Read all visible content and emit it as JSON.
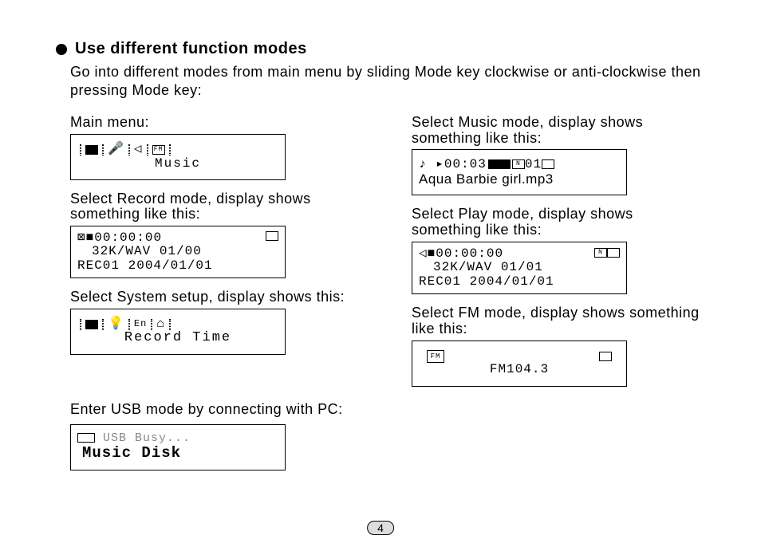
{
  "heading": "Use different function modes",
  "intro": "Go into different modes from main menu by sliding Mode key clockwise or anti-clockwise then pressing Mode key:",
  "left": {
    "main_menu_caption": "Main menu:",
    "main_menu_label": "Music",
    "record_caption": "Select Record mode, display shows something like this:",
    "record_line1": "■00:00:00",
    "record_line2": "32K/WAV 01/00",
    "record_line3": "REC01 2004/01/01",
    "system_caption": "Select System setup, display shows this:",
    "system_label": "Record Time",
    "usb_caption": "Enter USB mode by connecting with PC:",
    "usb_line1": "USB Busy...",
    "usb_line2": "Music Disk"
  },
  "right": {
    "music_caption": "Select Music mode, display shows something like this:",
    "music_line1": "♪ ▸00:03",
    "music_count": "01",
    "music_song": "Aqua Barbie girl.mp3",
    "play_caption": "Select Play mode, display shows something like this:",
    "play_line1": "◁■00:00:00",
    "play_line2": "32K/WAV 01/01",
    "play_line3": "REC01 2004/01/01",
    "fm_caption": "Select FM mode, display shows something like this:",
    "fm_icon_label": "FM",
    "fm_freq": "FM104.3"
  },
  "icons": {
    "fm": "FM",
    "en": "En",
    "n": "N"
  },
  "page": "4"
}
